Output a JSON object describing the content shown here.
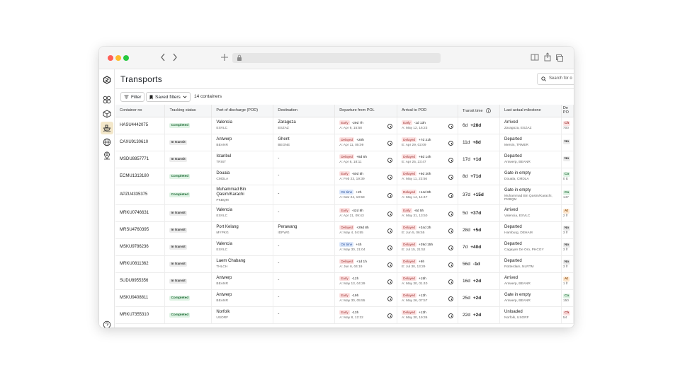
{
  "app": {
    "page_title": "Transports",
    "search_placeholder": "Search for o",
    "filter_label": "Filter",
    "saved_filters_label": "Saved filters",
    "container_count": "14 containers"
  },
  "columns": [
    "Container no",
    "Tracking status",
    "Port of discharge (POD)",
    "Destination",
    "Departure from POL",
    "Arrival to POD",
    "Transit time",
    "Last actual milestone",
    "De\nPO"
  ],
  "rows": [
    {
      "container": "HASU4442075",
      "status": "Completed",
      "pod": "Valencia",
      "pod_code": "ESVLC",
      "dest": "Zaragoza",
      "dest_code": "ESZAZ",
      "dep_tag": "Early",
      "dep_dev": "-29d 7h",
      "dep_date": "A: Apr 9, 15:58",
      "arr_tag": "Early",
      "arr_dev": "-1d 13h",
      "arr_date": "A: May 12, 16:23",
      "tt_days": "6d",
      "tt_dev": "+28d",
      "milestone": "Arrived",
      "milestone_loc": "Zaragoza, ESZAZ",
      "last_status": "Ch",
      "last_sub": "700"
    },
    {
      "container": "CAXU9130610",
      "status": "In transit",
      "pod": "Antwerp",
      "pod_code": "BEANR",
      "dest": "Ghent",
      "dest_code": "BEGNE",
      "dep_tag": "Delayed",
      "dep_dev": "+20h",
      "dep_date": "A: Apr 11, 05:09",
      "arr_tag": "Delayed",
      "arr_dev": "+7d 21h",
      "arr_date": "E: Apr 29, 02:09",
      "tt_days": "11d",
      "tt_dev": "+8d",
      "milestone": "Departed",
      "milestone_loc": "Mersin, TRMER",
      "last_status": "No",
      "last_sub": ""
    },
    {
      "container": "MSDU8857771",
      "status": "In transit",
      "pod": "Istanbul",
      "pod_code": "TRIST",
      "dest": "-",
      "dest_code": "",
      "dep_tag": "Delayed",
      "dep_dev": "+8d 6h",
      "dep_date": "A: Apr 8, 18:11",
      "arr_tag": "Delayed",
      "arr_dev": "+8d 14h",
      "arr_date": "E: Apr 25, 23:47",
      "tt_days": "17d",
      "tt_dev": "+1d",
      "milestone": "Departed",
      "milestone_loc": "Antwerp, BEANR",
      "last_status": "No",
      "last_sub": ""
    },
    {
      "container": "ECMU1313180",
      "status": "Completed",
      "pod": "Douala",
      "pod_code": "CMDLA",
      "dest": "-",
      "dest_code": "",
      "dep_tag": "Early",
      "dep_dev": "-60d 5h",
      "dep_date": "A: Feb 23, 19:39",
      "arr_tag": "Delayed",
      "arr_dev": "+9d 20h",
      "arr_date": "A: May 11, 23:56",
      "tt_days": "8d",
      "tt_dev": "+71d",
      "milestone": "Gate in empty",
      "milestone_loc": "Douala, CMDLA",
      "last_status": "Co",
      "last_sub": "0 E"
    },
    {
      "container": "APZU4335375",
      "status": "Completed",
      "pod": "Muhammad Bin Qasim/Karachi",
      "pod_code": "PKBQM",
      "dest": "-",
      "dest_code": "",
      "dep_tag": "On time",
      "dep_dev": "+2h",
      "dep_date": "A: Mar 24, 10:59",
      "arr_tag": "Delayed",
      "arr_dev": "+14d 8h",
      "arr_date": "A: May 14, 14:47",
      "tt_days": "37d",
      "tt_dev": "+15d",
      "milestone": "Gate in empty",
      "milestone_loc": "Muhammad Bin Qasim/Karachi, PKBQM",
      "last_status": "Co",
      "last_sub": "147"
    },
    {
      "container": "MRKU0746631",
      "status": "In transit",
      "pod": "Valencia",
      "pod_code": "ESVLC",
      "dest": "-",
      "dest_code": "",
      "dep_tag": "Early",
      "dep_dev": "-42d 8h",
      "dep_date": "A: Apr 21, 09:43",
      "arr_tag": "Early",
      "arr_dev": "-6d 5h",
      "arr_date": "A: May 31, 13:50",
      "tt_days": "5d",
      "tt_dev": "+37d",
      "milestone": "Arrived",
      "milestone_loc": "Valencia, ESVLC",
      "last_status": "At",
      "last_sub": "2 fr"
    },
    {
      "container": "MRSU4760395",
      "status": "In transit",
      "pod": "Port Kelang",
      "pod_code": "MYPKG",
      "dest": "Perawang",
      "dest_code": "IDPWG",
      "dep_tag": "Delayed",
      "dep_dev": "+29d 8h",
      "dep_date": "A: May 4, 04:55",
      "arr_tag": "Delayed",
      "arr_dev": "+34d 2h",
      "arr_date": "E: Jun 5, 06:55",
      "tt_days": "28d",
      "tt_dev": "+5d",
      "milestone": "Departed",
      "milestone_loc": "Hamburg, DEHAM",
      "last_status": "No",
      "last_sub": "3 fr"
    },
    {
      "container": "MSKU9786236",
      "status": "In transit",
      "pod": "Valencia",
      "pod_code": "ESVLC",
      "dest": "-",
      "dest_code": "",
      "dep_tag": "On time",
      "dep_dev": "+4h",
      "dep_date": "A: May 30, 21:04",
      "arr_tag": "Delayed",
      "arr_dev": "+39d 15h",
      "arr_date": "E: Jul 15, 21:52",
      "tt_days": "7d",
      "tt_dev": "+40d",
      "milestone": "Departed",
      "milestone_loc": "Cagayan De Oro, PHCGY",
      "last_status": "No",
      "last_sub": "3 fr"
    },
    {
      "container": "MRKU0811362",
      "status": "In transit",
      "pod": "Laem Chabang",
      "pod_code": "THLCH",
      "dest": "-",
      "dest_code": "",
      "dep_tag": "Delayed",
      "dep_dev": "+1d 1h",
      "dep_date": "A: Jun 6, 04:19",
      "arr_tag": "Delayed",
      "arr_dev": "+9h",
      "arr_date": "E: Jul 30, 13:29",
      "tt_days": "56d",
      "tt_dev": "-1d",
      "milestone": "Departed",
      "milestone_loc": "Rotterdam, NLRTM",
      "last_status": "No",
      "last_sub": "3 fr"
    },
    {
      "container": "SUDU8955356",
      "status": "In transit",
      "pod": "Antwerp",
      "pod_code": "BEANR",
      "dest": "-",
      "dest_code": "",
      "dep_tag": "Early",
      "dep_dev": "-12h",
      "dep_date": "A: May 13, 04:29",
      "arr_tag": "Delayed",
      "arr_dev": "+15h",
      "arr_date": "A: May 30, 01:40",
      "tt_days": "16d",
      "tt_dev": "+2d",
      "milestone": "Arrived",
      "milestone_loc": "Antwerp, BEANR",
      "last_status": "At",
      "last_sub": "1 fr"
    },
    {
      "container": "MSKU9408811",
      "status": "Completed",
      "pod": "Antwerp",
      "pod_code": "BEANR",
      "dest": "-",
      "dest_code": "",
      "dep_tag": "Early",
      "dep_dev": "-19h",
      "dep_date": "A: May 30, 05:55",
      "arr_tag": "Delayed",
      "arr_dev": "+13h",
      "arr_date": "A: May 26, 07:57",
      "tt_days": "25d",
      "tt_dev": "+2d",
      "milestone": "Gate in empty",
      "milestone_loc": "Antwerp, BEANR",
      "last_status": "Co",
      "last_sub": "150"
    },
    {
      "container": "MRKU7355310",
      "status": "Completed",
      "pod": "Norfolk",
      "pod_code": "USORF",
      "dest": "-",
      "dest_code": "",
      "dep_tag": "Early",
      "dep_dev": "-13h",
      "dep_date": "A: May 8, 12:22",
      "arr_tag": "Delayed",
      "arr_dev": "+13h",
      "arr_date": "A: May 30, 19:36",
      "tt_days": "22d",
      "tt_dev": "+2d",
      "milestone": "Unloaded",
      "milestone_loc": "Norfolk, USORF",
      "last_status": "Ch",
      "last_sub": "54"
    }
  ],
  "colors": {
    "completed_bg": "#e0f3e5",
    "delayed_bg": "#fde3e3",
    "ontime_bg": "#dde8fb",
    "active_nav_bg": "#f3e7c9"
  },
  "icons": [
    "back-icon",
    "forward-icon",
    "add-tab-icon",
    "lock-icon",
    "book-icon",
    "share-icon",
    "copy-icon",
    "logo-icon",
    "dashboard-icon",
    "box-icon",
    "ship-icon",
    "globe-icon",
    "location-icon",
    "help-icon",
    "filter-icon",
    "bookmark-icon",
    "search-icon",
    "info-icon"
  ]
}
